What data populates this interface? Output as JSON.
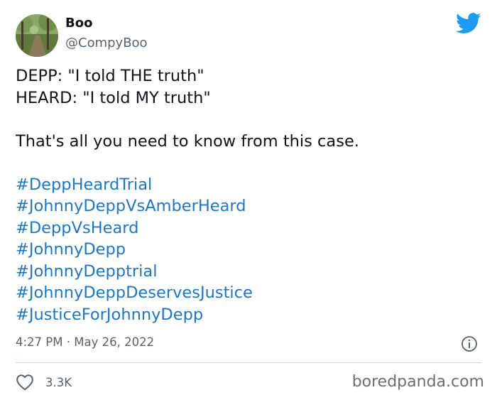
{
  "author": {
    "display_name": "Boo",
    "handle": "@CompyBoo"
  },
  "tweet": {
    "lines": [
      "DEPP: \"I told THE truth\"",
      "HEARD: \"I told MY truth\"",
      "That's all you need to know from this case."
    ],
    "hashtags": [
      "#DeppHeardTrial",
      "#JohnnyDeppVsAmberHeard",
      "#DeppVsHeard",
      "#JohnnyDepp",
      "#JohnnyDepptrial",
      "#JohnnyDeppDeservesJustice",
      "#JusticeForJohnnyDepp"
    ]
  },
  "meta": {
    "time": "4:27 PM",
    "separator": "·",
    "date": "May 26, 2022"
  },
  "engagement": {
    "likes": "3.3K"
  },
  "watermark": "boredpanda.com",
  "colors": {
    "twitter_blue": "#1d9bf0",
    "hashtag": "#1d77c5",
    "secondary_text": "#536471"
  },
  "icons": {
    "brand": "twitter-bird-icon",
    "info": "info-icon",
    "like": "heart-icon"
  }
}
